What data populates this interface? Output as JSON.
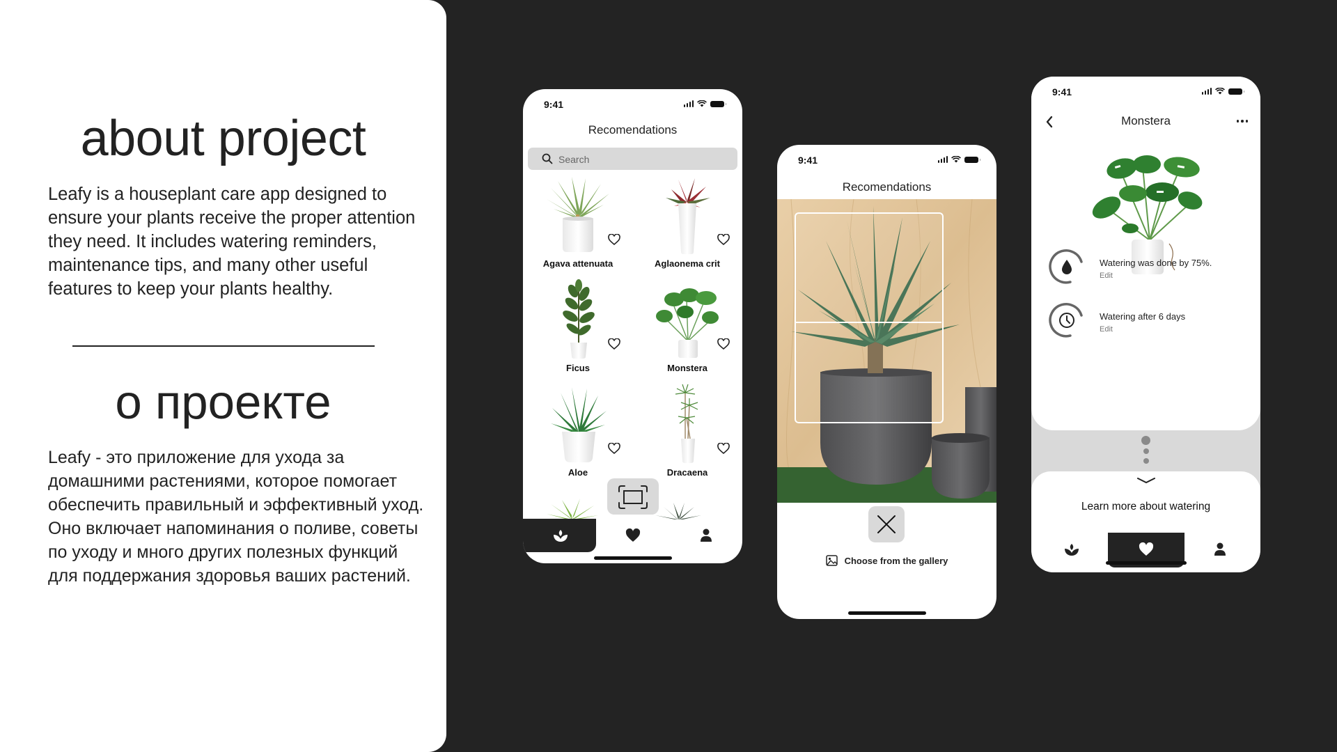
{
  "about": {
    "title_en": "about project",
    "body_en": "Leafy is a houseplant care app designed to ensure your plants receive the proper attention they need. It includes watering reminders, maintenance tips, and many other useful features to keep your plants healthy.",
    "title_ru": "о проекте",
    "body_ru": "Leafy - это приложение для ухода за домашними растениями, которое помогает обеспечить правильный и эффективный уход. Оно включает напоминания о поливе, советы по уходу и много других полезных функций для поддержания здоровья ваших растений."
  },
  "colors": {
    "background": "#232323",
    "panel": "#ffffff",
    "accent_dark": "#232323",
    "chip_grey": "#d9d9d9"
  },
  "status_bar": {
    "time": "9:41"
  },
  "phone_recommendations": {
    "title": "Recomendations",
    "search_placeholder": "Search",
    "plants": [
      {
        "name": "Agava attenuata",
        "favorite": false
      },
      {
        "name": "Aglaonema crit",
        "favorite": false
      },
      {
        "name": "Ficus",
        "favorite": false
      },
      {
        "name": "Monstera",
        "favorite": false
      },
      {
        "name": "Aloe",
        "favorite": false
      },
      {
        "name": "Dracaena",
        "favorite": false
      }
    ],
    "scan_button_icon": "scan-frame-icon",
    "tabs": [
      {
        "icon": "plant-icon",
        "active": true
      },
      {
        "icon": "heart-icon",
        "active": false
      },
      {
        "icon": "user-icon",
        "active": false
      }
    ]
  },
  "phone_scan": {
    "title": "Recomendations",
    "close_icon": "close-icon",
    "gallery_label": "Choose from the gallery",
    "gallery_icon": "image-icon"
  },
  "phone_detail": {
    "title": "Monstera",
    "back_icon": "chevron-left-icon",
    "more_icon": "more-horizontal-icon",
    "stats": [
      {
        "icon": "water-drop-icon",
        "text": "Watering was done by 75%.",
        "action": "Edit",
        "progress": 0.75
      },
      {
        "icon": "clock-icon",
        "text": "Watering after 6 days",
        "action": "Edit"
      }
    ],
    "pager": {
      "count": 3,
      "active": 0
    },
    "learn_more": "Learn more about watering",
    "tabs": [
      {
        "icon": "plant-icon",
        "active": false
      },
      {
        "icon": "heart-icon",
        "active": true
      },
      {
        "icon": "user-icon",
        "active": false
      }
    ]
  }
}
